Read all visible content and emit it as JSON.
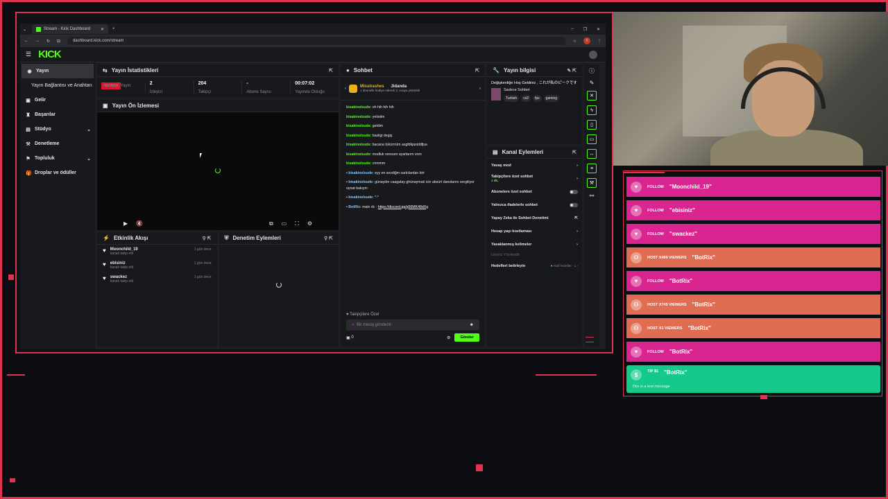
{
  "browser": {
    "tab_title": "Stream - Kick Dashboard",
    "url": "dashboard.kick.com/stream",
    "notification_count": "0"
  },
  "kick": {
    "logo": "KICK",
    "accent": "#53fc18"
  },
  "sidebar": {
    "items": [
      {
        "label": "Yayın",
        "icon": "broadcast-icon"
      },
      {
        "label": "Yayın Bağlantısı ve Anahtarı",
        "icon": ""
      },
      {
        "label": "Gelir",
        "icon": "wallet-icon"
      },
      {
        "label": "Başarılar",
        "icon": "trophy-icon"
      },
      {
        "label": "Stüdyo",
        "icon": "studio-icon"
      },
      {
        "label": "Denetleme",
        "icon": "hammer-icon"
      },
      {
        "label": "Topluluk",
        "icon": "community-icon"
      },
      {
        "label": "Droplar ve ödüller",
        "icon": "gift-icon"
      }
    ]
  },
  "stats": {
    "title": "Yayın İstatistikleri",
    "live_badge": "YAYINDA",
    "items": [
      {
        "value": "",
        "label": "Yayın"
      },
      {
        "value": "2",
        "label": "İzleyici"
      },
      {
        "value": "204",
        "label": "Takipçi"
      },
      {
        "value": "-",
        "label": "Abone Sayısı"
      },
      {
        "value": "00:07:02",
        "label": "Yayında Olduğu"
      }
    ]
  },
  "preview": {
    "title": "Yayın Ön İzlemesi"
  },
  "activity": {
    "title": "Etkinlik Akışı",
    "items": [
      {
        "name": "Moonchild_19",
        "sub": "kanalı takip etti",
        "when": "1 gün önce"
      },
      {
        "name": "ebisiniz",
        "sub": "kanalı takip etti",
        "when": "1 gün önce"
      },
      {
        "name": "swackez",
        "sub": "kanalı takip etti",
        "when": "1 gün önce"
      }
    ]
  },
  "moderation": {
    "title": "Denetim Eylemleri"
  },
  "chat": {
    "title": "Sohbet",
    "pinned_user": "Misstrashes",
    "pinned_target": "Jidanda",
    "pinned_text": "1 abonelik hediye ederek 3. sıraya yükseldi",
    "messages": [
      {
        "user": "bisakinolsude:",
        "text": "oh hih hih hih",
        "blue": false
      },
      {
        "user": "bisakinolsude:",
        "text": "yetistim",
        "blue": false
      },
      {
        "user": "bisakinolsude:",
        "text": "geldim",
        "blue": false
      },
      {
        "user": "bisakinolsude:",
        "text": "basligi degiş",
        "blue": false
      },
      {
        "user": "bisakinolsude:",
        "text": "bacana tükürrrüm asgfdkjasiddfjsa",
        "blue": false
      },
      {
        "user": "bisakinolsude:",
        "text": "modluk veresen ayarlarım vnm",
        "blue": false
      },
      {
        "user": "bisakinolsude:",
        "text": "cnmmm",
        "blue": false
      },
      {
        "user": "bisakinolsude:",
        "text": "eyy en sevdiğm sarkılardan biri",
        "blue": true
      },
      {
        "user": "bisakinolsude:",
        "text": "günaydın caagatay ghünaymak icin absürt danslarını sergiliyor oynat bakıym",
        "blue": true
      },
      {
        "user": "bisakinolsude:",
        "text": "*-*",
        "blue": true
      },
      {
        "user": "BotRix:",
        "text": "main dc : ",
        "link": "https://discord.gg/g56MK48dXg",
        "blue": true
      }
    ],
    "followers_only": "Takipçilere Özel",
    "input_placeholder": "Bir mesaj gönderin",
    "count": "0",
    "send": "Gönder"
  },
  "stream_info": {
    "title": "Yayın bilgisi",
    "headline": "Değişkenliğe Hoş Geldiniz , これが私のピークです",
    "category": "Sadece Sohbet",
    "tags": [
      "Turkish",
      "cs2",
      "fps",
      "gaming"
    ]
  },
  "channel_actions": {
    "title": "Kanal Eylemleri",
    "rows": [
      {
        "label": "Yavaş mod",
        "end": "chevron"
      },
      {
        "label": "Takipçilere özel sohbet",
        "sub": "1 dk.",
        "end": "chevron"
      },
      {
        "label": "Abonelere özel sohbet",
        "end": "toggle"
      },
      {
        "label": "Yalnızca ifadelerle sohbet",
        "end": "toggle"
      },
      {
        "label": "Yapay Zeka ile Sohbet Denetimi",
        "end": "external"
      },
      {
        "label": "Hesap yaşı kısıtlaması",
        "end": "chevron"
      },
      {
        "label": "Yasaklanmış kelimeler",
        "end": "chevron"
      },
      {
        "label": "İzleyici Yönlendir",
        "end": "",
        "dim": true
      },
      {
        "label": "Hedefleri belirleyin",
        "end": "Aktif hedefler - 1"
      }
    ]
  },
  "alerts": [
    {
      "type": "FOLLOW",
      "name": "\"Moonchild_19\"",
      "kind": "follow"
    },
    {
      "type": "FOLLOW",
      "name": "\"ebisiniz\"",
      "kind": "follow"
    },
    {
      "type": "FOLLOW",
      "name": "\"swackez\"",
      "kind": "follow"
    },
    {
      "type": "HOST X489 VIEWERS",
      "name": "\"BotRix\"",
      "kind": "host"
    },
    {
      "type": "FOLLOW",
      "name": "\"BotRix\"",
      "kind": "follow"
    },
    {
      "type": "HOST X745 VIEWERS",
      "name": "\"BotRix\"",
      "kind": "host"
    },
    {
      "type": "HOST X1 VIEWERS",
      "name": "\"BotRix\"",
      "kind": "host"
    },
    {
      "type": "FOLLOW",
      "name": "\"BotRix\"",
      "kind": "follow"
    },
    {
      "type": "TIP $1",
      "name": "\"BotRix\"",
      "kind": "tip",
      "message": "This is a test message"
    }
  ]
}
